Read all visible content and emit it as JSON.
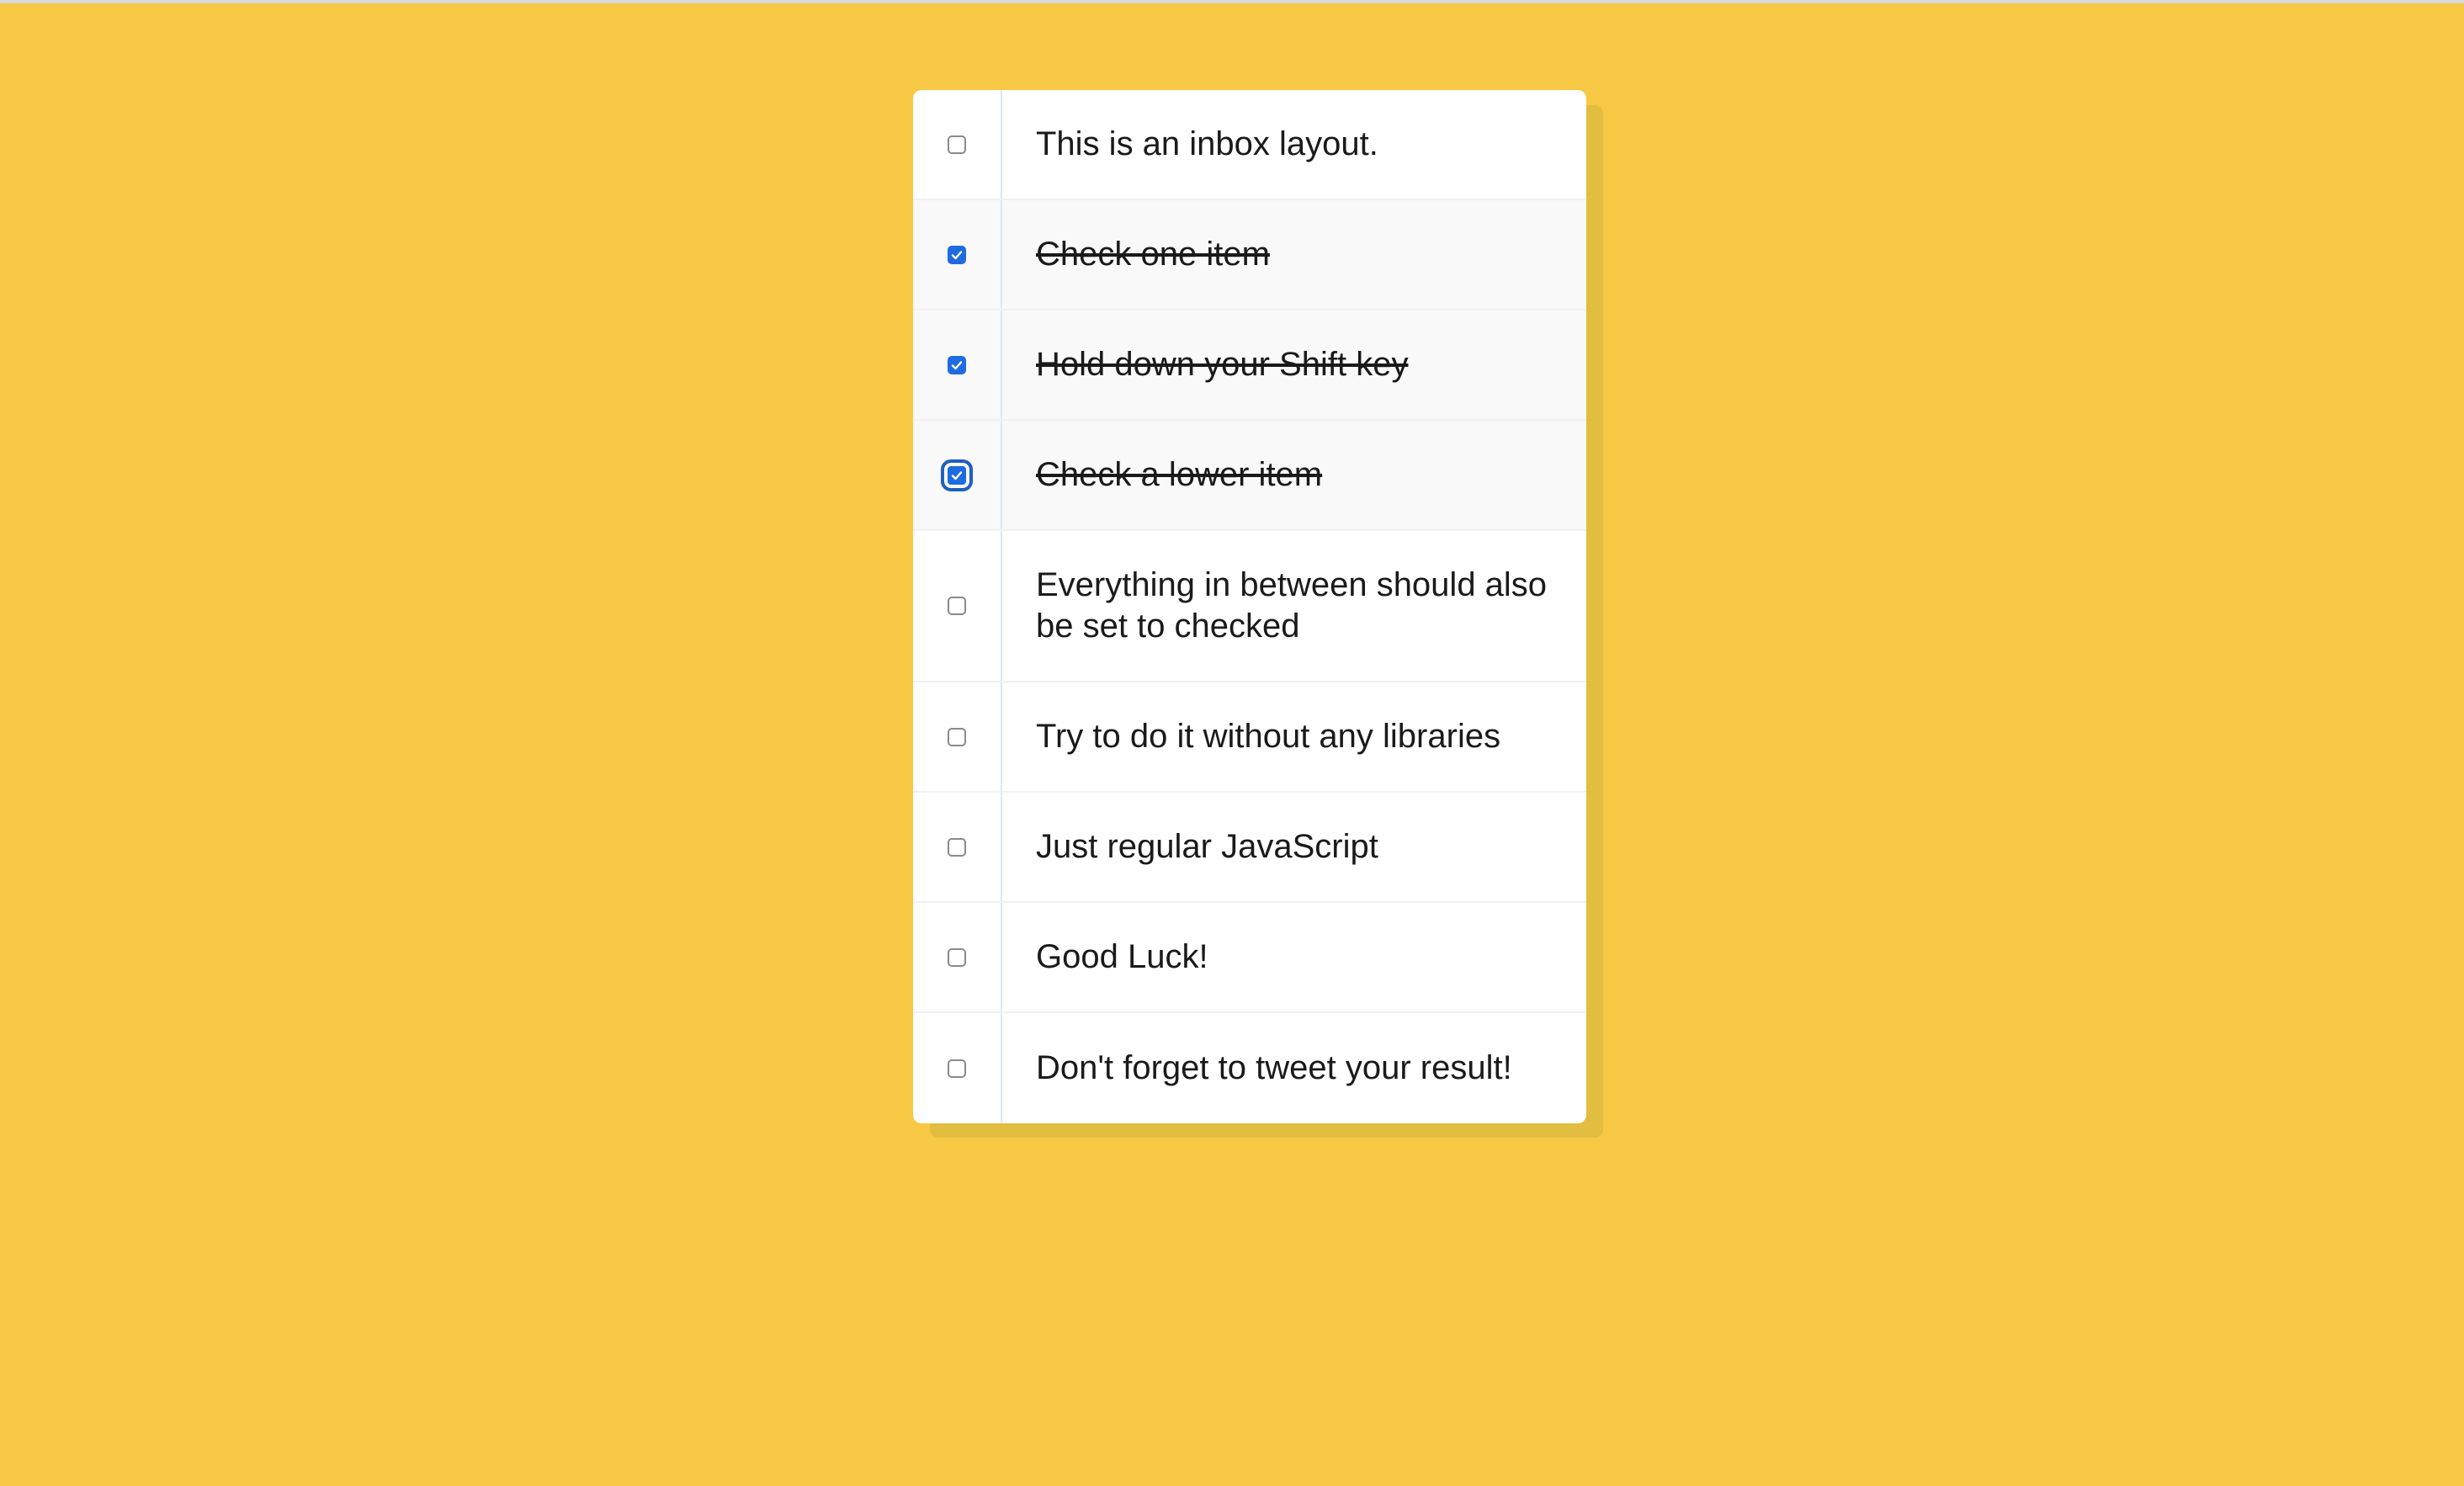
{
  "inbox": {
    "items": [
      {
        "label": "This is an inbox layout.",
        "checked": false
      },
      {
        "label": "Check one item",
        "checked": true
      },
      {
        "label": "Hold down your Shift key",
        "checked": true
      },
      {
        "label": "Check a lower item",
        "checked": true,
        "focused": true
      },
      {
        "label": "Everything in between should also be set to checked",
        "checked": false
      },
      {
        "label": "Try to do it without any libraries",
        "checked": false
      },
      {
        "label": "Just regular JavaScript",
        "checked": false
      },
      {
        "label": "Good Luck!",
        "checked": false
      },
      {
        "label": "Don't forget to tweet your result!",
        "checked": false
      }
    ]
  },
  "icons": {
    "checkbox_mark": "checkmark-icon"
  },
  "colors": {
    "background": "#F7C843",
    "card": "#FFFFFF",
    "card_shadow": "#E1BD40",
    "checked_fill": "#1F6BE0",
    "divider": "#DDE7F5",
    "text": "#1A1A1A"
  }
}
